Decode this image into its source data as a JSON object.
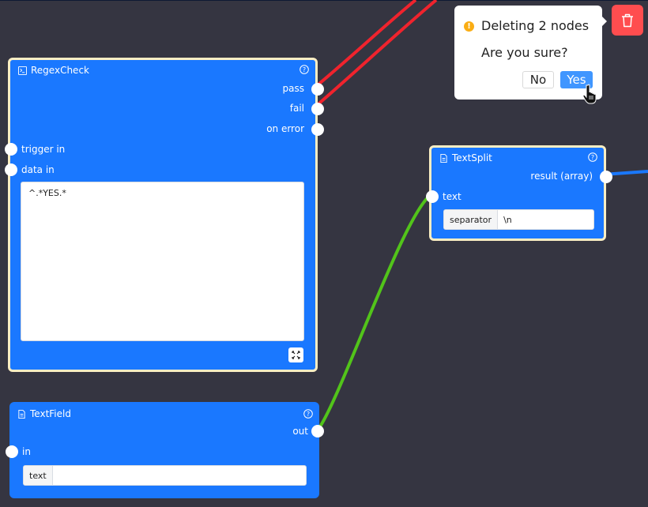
{
  "colors": {
    "canvas_bg": "#353541",
    "node_bg": "#1a78ff",
    "node_selected_border": "#fbeec3",
    "wire_fail": "#f0232d",
    "wire_pass": "#f0232d",
    "wire_text": "#52c41a",
    "wire_result": "#1a78ff",
    "danger": "#ff4d4f",
    "primary": "#4096ff",
    "warning": "#faad14"
  },
  "nodes": {
    "regex_check": {
      "title": "RegexCheck",
      "icon": "terminal-icon",
      "selected": true,
      "outputs": [
        "pass",
        "fail",
        "on error"
      ],
      "inputs": [
        "trigger in",
        "data in"
      ],
      "pattern_value": "^.*YES.*"
    },
    "text_split": {
      "title": "TextSplit",
      "icon": "file-text-icon",
      "selected": true,
      "outputs": [
        "result (array)"
      ],
      "inputs": [
        "text"
      ],
      "separator_label": "separator",
      "separator_value": "\\n"
    },
    "text_field": {
      "title": "TextField",
      "icon": "file-text-icon",
      "selected": false,
      "outputs": [
        "out"
      ],
      "inputs": [
        "in"
      ],
      "text_label": "text",
      "text_value": ""
    }
  },
  "confirm_popover": {
    "title": "Deleting 2 nodes",
    "message": "Are you sure?",
    "no_label": "No",
    "yes_label": "Yes"
  },
  "toolbar": {
    "delete_icon": "trash-icon"
  }
}
